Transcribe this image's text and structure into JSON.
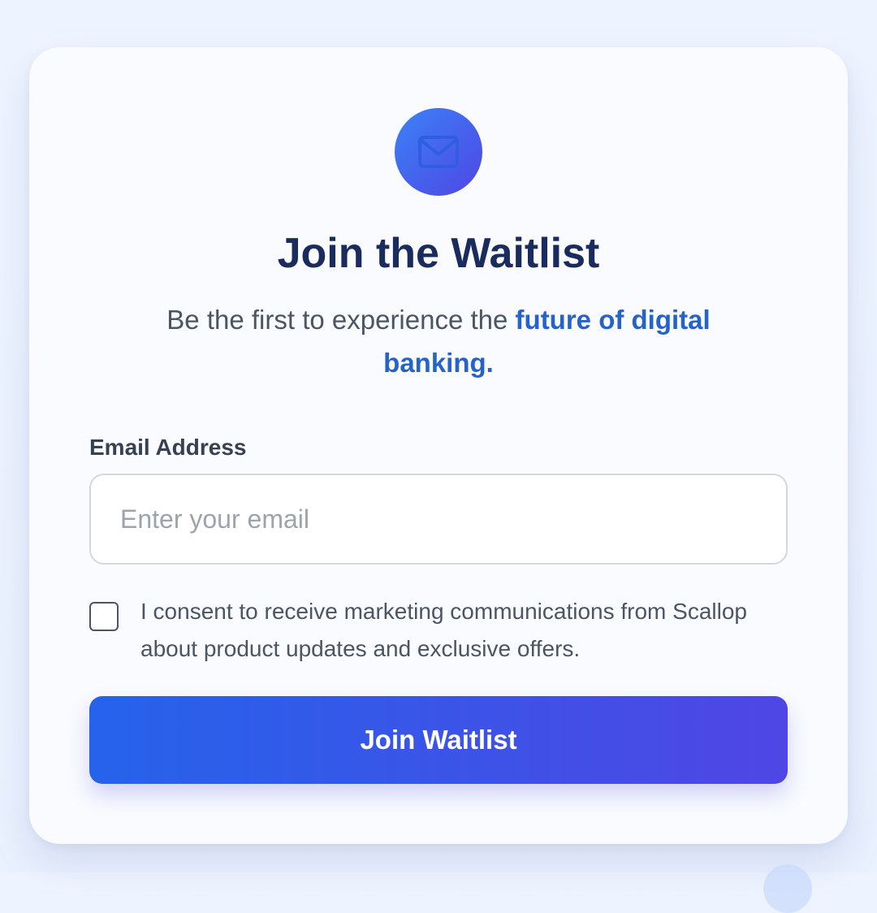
{
  "form": {
    "icon": "envelope-icon",
    "title": "Join the Waitlist",
    "subtitle_prefix": "Be the first to experience the ",
    "subtitle_highlight": "future of digital banking.",
    "email_label": "Email Address",
    "email_placeholder": "Enter your email",
    "email_value": "",
    "consent_text": "I consent to receive marketing communications from Scallop about product updates and exclusive offers.",
    "consent_checked": false,
    "submit_label": "Join Waitlist"
  },
  "colors": {
    "title": "#1a2b5e",
    "highlight": "#2563c9",
    "button_gradient_start": "#2563eb",
    "button_gradient_end": "#4f46e5"
  }
}
